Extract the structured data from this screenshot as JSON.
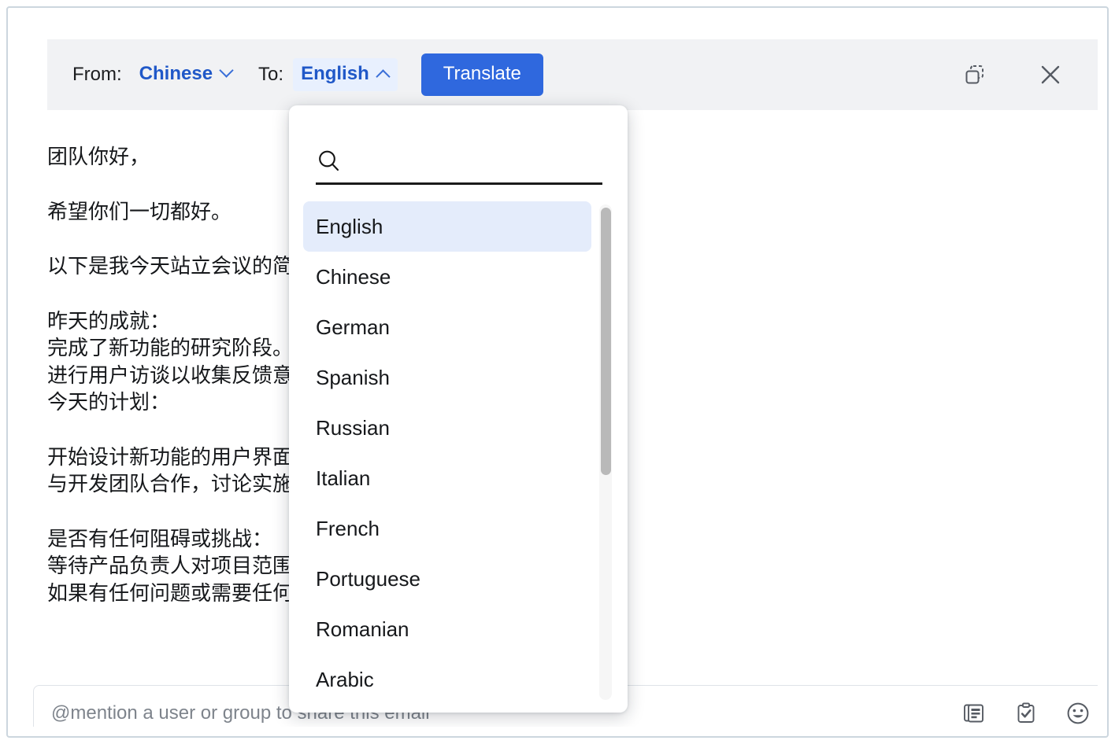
{
  "toolbar": {
    "from_label": "From:",
    "from_language": "Chinese",
    "to_label": "To:",
    "to_language": "English",
    "translate_label": "Translate",
    "copy_icon": "copy-duplicate-icon",
    "close_icon": "close-icon",
    "accent_color": "#2f68de",
    "chip_bg": "#e8f0fe",
    "bar_bg": "#f1f2f4"
  },
  "email": {
    "lines": [
      "团队你好，",
      "",
      "希望你们一切都好。",
      "",
      "以下是我今天站立会议的简",
      "",
      "昨天的成就：",
      "完成了新功能的研究阶段。",
      "进行用户访谈以收集反馈意",
      "今天的计划：",
      "",
      "开始设计新功能的用户界面",
      "与开发团队合作，讨论实施",
      "",
      "是否有任何阻碍或挑战：",
      "等待产品负责人对项目范围",
      "如果有任何问题或需要任何"
    ]
  },
  "dropdown": {
    "search_placeholder": "",
    "search_value": "",
    "search_icon": "search-icon",
    "selected": "English",
    "highlight_color": "#e4ecfb",
    "items": [
      "English",
      "Chinese",
      "German",
      "Spanish",
      "Russian",
      "Italian",
      "French",
      "Portuguese",
      "Romanian",
      "Arabic"
    ]
  },
  "mention": {
    "placeholder": "@mention a user or group to share this email",
    "value": "",
    "icons": [
      "templates-icon",
      "task-clipboard-icon",
      "emoji-icon"
    ]
  }
}
